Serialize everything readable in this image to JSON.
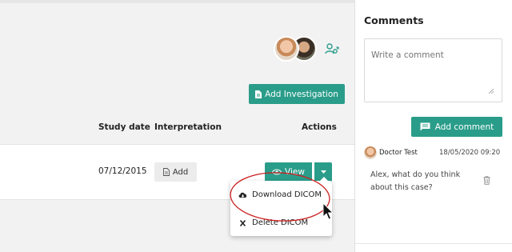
{
  "table": {
    "headers": {
      "study_date": "Study date",
      "interpretation": "Interpretation",
      "actions": "Actions"
    },
    "rows": [
      {
        "study_date": "07/12/2015",
        "interpretation_button": "Add",
        "view_button": "View"
      }
    ]
  },
  "toolbar": {
    "add_investigation_label": "Add Investigation"
  },
  "dropdown": {
    "items": [
      {
        "label": "Download DICOM",
        "icon": "cloud-download-icon"
      },
      {
        "label": "Delete DICOM",
        "icon": "close-icon"
      }
    ]
  },
  "comments": {
    "title": "Comments",
    "placeholder": "Write a comment",
    "add_button": "Add comment",
    "items": [
      {
        "author": "Doctor Test",
        "date": "18/05/2020 09:20",
        "text": "Alex, what do you think about this case?"
      }
    ]
  },
  "colors": {
    "accent": "#2a9d8a",
    "annotation": "#cc1f1f"
  },
  "icons": [
    "share-users-icon",
    "document-icon",
    "eye-icon",
    "caret-down-icon",
    "cloud-download-icon",
    "close-icon",
    "comment-icon",
    "trash-icon"
  ]
}
